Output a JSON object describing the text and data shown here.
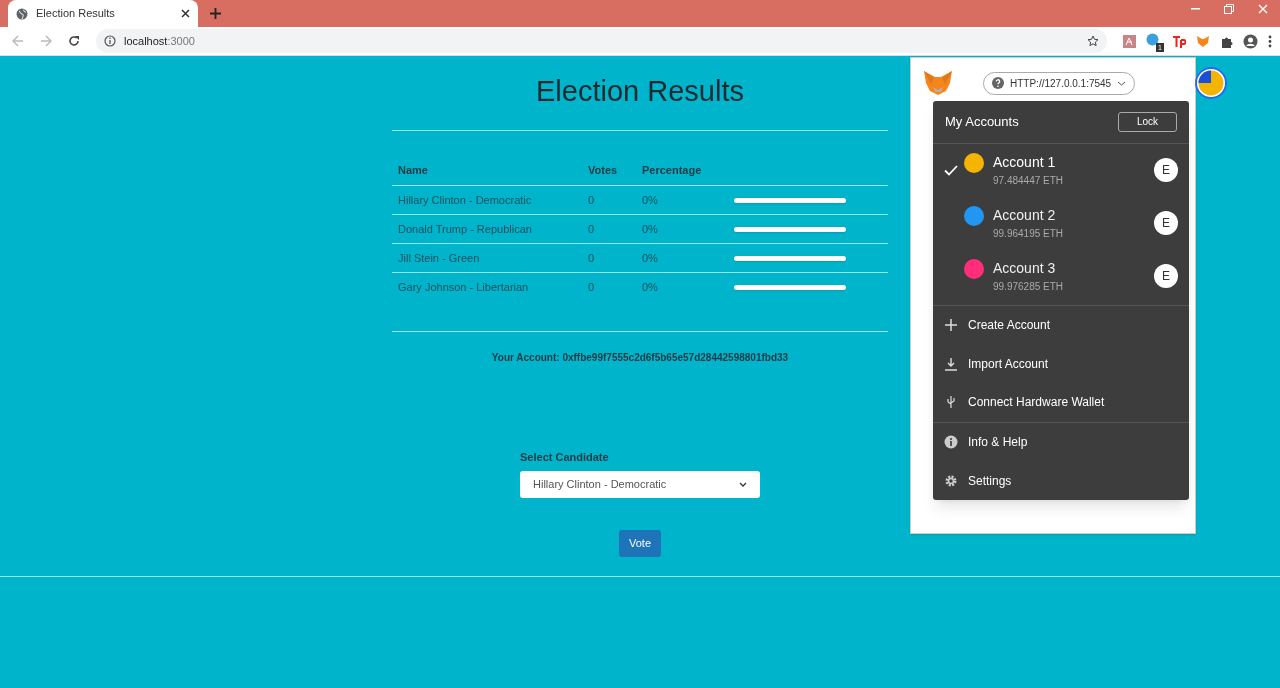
{
  "browser": {
    "tab_title": "Election Results",
    "url_host": "localhost",
    "url_port": ":3000",
    "extension_badge": "1"
  },
  "page": {
    "title": "Election Results",
    "table": {
      "columns": [
        "Name",
        "Votes",
        "Percentage"
      ],
      "rows": [
        {
          "name": "Hillary Clinton - Democratic",
          "votes": "0",
          "percentage": "0%",
          "level": 0
        },
        {
          "name": "Donald Trump - Republican",
          "votes": "0",
          "percentage": "0%",
          "level": 0
        },
        {
          "name": "Jill Stein - Green",
          "votes": "0",
          "percentage": "0%",
          "level": 0
        },
        {
          "name": "Gary Johnson - Libertarian",
          "votes": "0",
          "percentage": "0%",
          "level": 0
        }
      ]
    },
    "account_label": "Your Account:",
    "account_address": "0xffbe99f7555c2d6f5b65e57d28442598801fbd33",
    "select_label": "Select Candidate",
    "select_value": "Hillary Clinton - Democratic",
    "vote_button": "Vote"
  },
  "wallet": {
    "network": "HTTP://127.0.0.1:7545",
    "menu": {
      "title": "My Accounts",
      "lock_button": "Lock",
      "accounts": [
        {
          "name": "Account 1",
          "balance": "97.484447 ETH",
          "selected": true,
          "badge": "E",
          "color": "#f5b400"
        },
        {
          "name": "Account 2",
          "balance": "99.964195 ETH",
          "selected": false,
          "badge": "E",
          "color": "#2196f3"
        },
        {
          "name": "Account 3",
          "balance": "99.976285 ETH",
          "selected": false,
          "badge": "E",
          "color": "#ff2d7a"
        }
      ],
      "actions": [
        {
          "kind": "plus",
          "label": "Create Account"
        },
        {
          "kind": "download",
          "label": "Import Account"
        },
        {
          "kind": "usb",
          "label": "Connect Hardware Wallet"
        },
        {
          "kind": "info",
          "label": "Info & Help"
        },
        {
          "kind": "gear",
          "label": "Settings"
        }
      ]
    }
  }
}
